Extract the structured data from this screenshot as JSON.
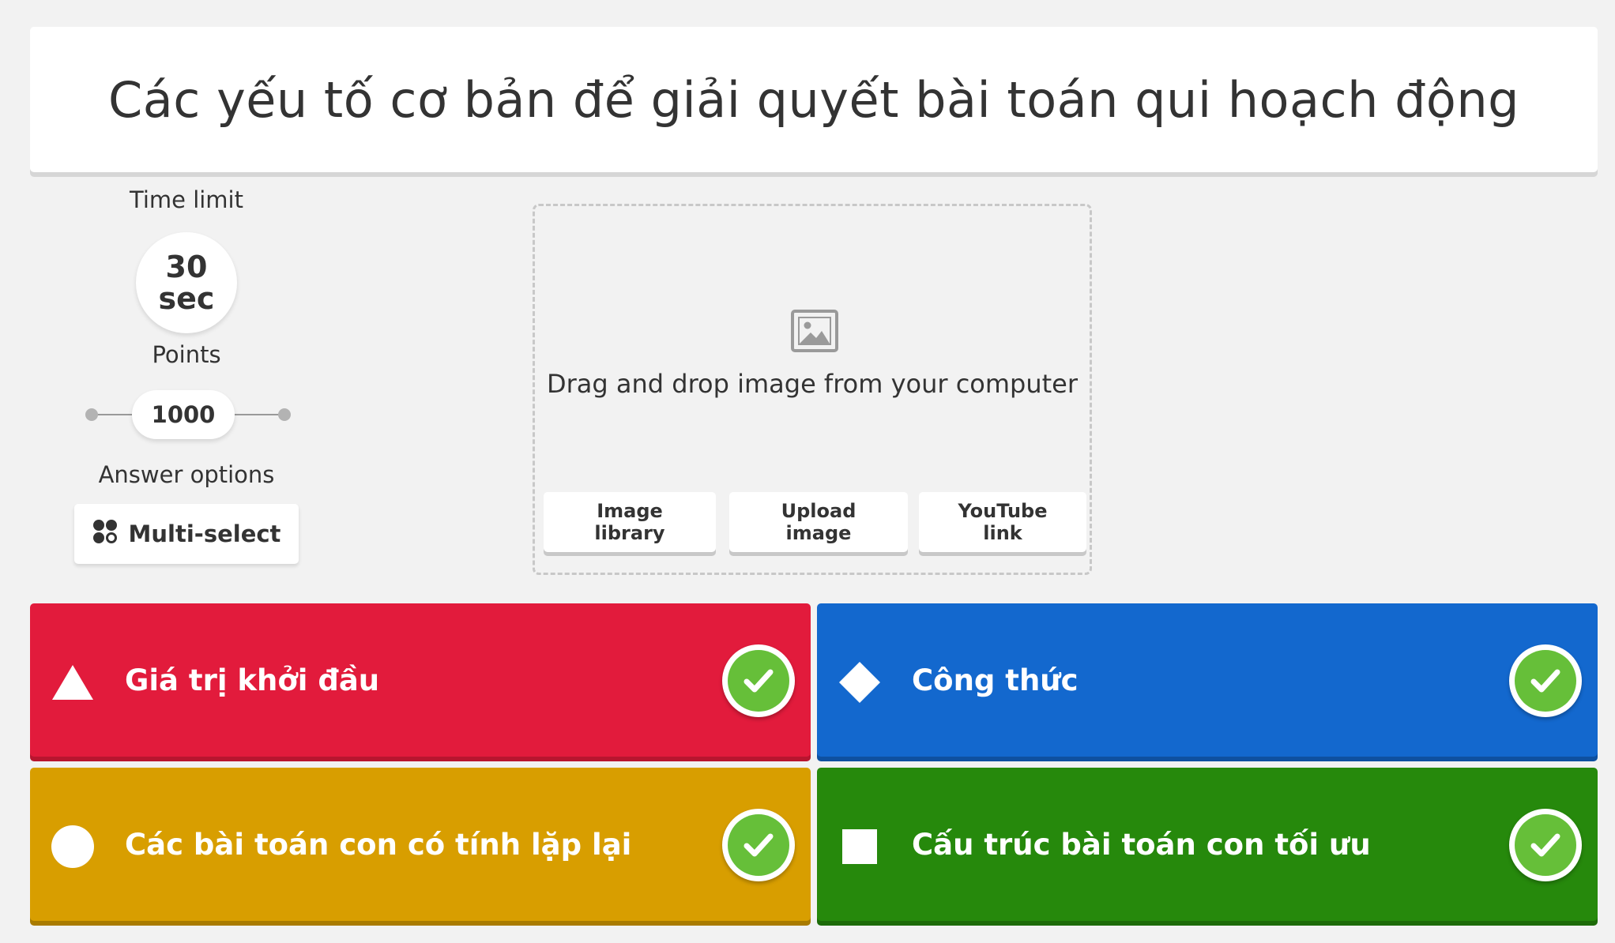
{
  "question": {
    "title": "Các yếu tố cơ bản để giải quyết bài toán qui hoạch động"
  },
  "settings": {
    "time_limit_label": "Time limit",
    "time_value": "30",
    "time_unit": "sec",
    "points_label": "Points",
    "points_value": "1000",
    "answer_options_label": "Answer options",
    "answer_mode": "Multi-select"
  },
  "media": {
    "drop_text": "Drag and drop image from your computer",
    "buttons": [
      {
        "line1": "Image",
        "line2": "library"
      },
      {
        "line1": "Upload",
        "line2": "image"
      },
      {
        "line1": "YouTube",
        "line2": "link"
      }
    ]
  },
  "answers": [
    {
      "text": "Giá trị khởi đầu",
      "shape": "triangle-icon",
      "color": "#e21b3c",
      "correct": true
    },
    {
      "text": "Công thức",
      "shape": "diamond-icon",
      "color": "#1368ce",
      "correct": true
    },
    {
      "text": "Các bài toán con có tính lặp lại",
      "shape": "circle-icon",
      "color": "#d89e00",
      "correct": true
    },
    {
      "text": "Cấu trúc bài toán con tối ưu",
      "shape": "square-icon",
      "color": "#26890c",
      "correct": true
    }
  ]
}
